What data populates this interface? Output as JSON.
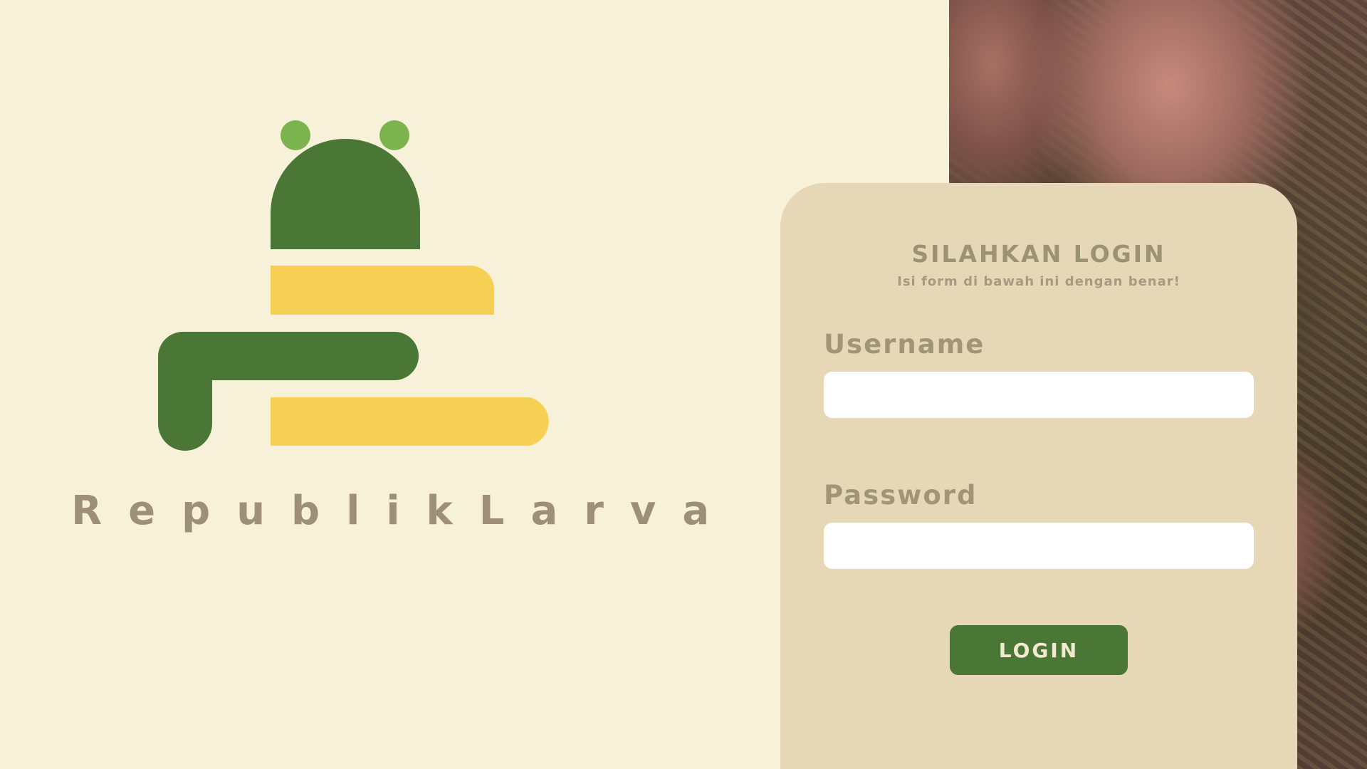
{
  "brand": {
    "name": "RepublikLarva",
    "logo_colors": {
      "dark_green": "#4a7735",
      "light_green": "#7bb34f",
      "yellow": "#f5d054"
    },
    "text_color": "#9e9077"
  },
  "background": {
    "page_color": "#f6f1d8",
    "photo": "larvae-in-hands-photo"
  },
  "login": {
    "title": "SILAHKAN LOGIN",
    "subtitle": "Isi form di bawah ini dengan benar!",
    "username_label": "Username",
    "username_value": "",
    "password_label": "Password",
    "password_value": "",
    "button_label": "LOGIN",
    "card_color": "#e6d8b7",
    "button_color": "#4a7735"
  }
}
